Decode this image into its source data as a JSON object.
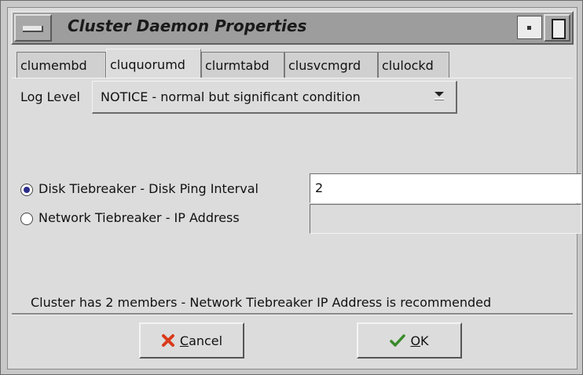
{
  "window": {
    "title": "Cluster Daemon Properties"
  },
  "tabs": [
    {
      "label": "clumembd"
    },
    {
      "label": "cluquorumd"
    },
    {
      "label": "clurmtabd"
    },
    {
      "label": "clusvcmgrd"
    },
    {
      "label": "clulockd"
    }
  ],
  "active_tab": "cluquorumd",
  "log_level": {
    "label": "Log Level",
    "value": "NOTICE - normal but significant condition"
  },
  "tiebreaker": {
    "disk_label": "Disk Tiebreaker - Disk Ping Interval",
    "disk_value": "2",
    "network_label": "Network Tiebreaker - IP Address",
    "network_value": "",
    "selected": "disk"
  },
  "status_text": "Cluster has 2 members - Network Tiebreaker IP Address is recommended",
  "buttons": {
    "cancel_mnemonic": "C",
    "cancel_rest": "ancel",
    "ok_mnemonic": "O",
    "ok_rest": "K"
  },
  "colors": {
    "cancel_icon": "#d93a1a",
    "ok_icon": "#3a8a2a",
    "radio_selected": "#2c2c8c"
  }
}
